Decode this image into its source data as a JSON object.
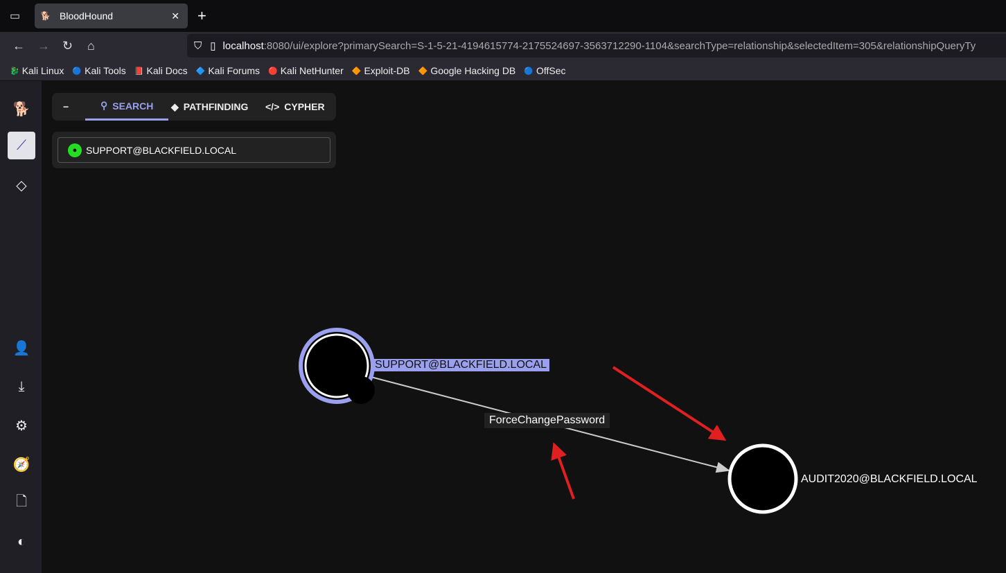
{
  "browser": {
    "tab_title": "BloodHound",
    "url_host": "localhost",
    "url_rest": ":8080/ui/explore?primarySearch=S-1-5-21-4194615774-2175524697-3563712290-1104&searchType=relationship&selectedItem=305&relationshipQueryTy",
    "bookmarks": [
      "Kali Linux",
      "Kali Tools",
      "Kali Docs",
      "Kali Forums",
      "Kali NetHunter",
      "Exploit-DB",
      "Google Hacking DB",
      "OffSec"
    ]
  },
  "search_panel": {
    "collapse": "−",
    "tabs": [
      "SEARCH",
      "PATHFINDING",
      "CYPHER"
    ],
    "query": "SUPPORT@BLACKFIELD.LOCAL"
  },
  "graph": {
    "source": "SUPPORT@BLACKFIELD.LOCAL",
    "target": "AUDIT2020@BLACKFIELD.LOCAL",
    "edge": "ForceChangePassword",
    "selected_color": "#9ba0ee",
    "annotation_color": "#e02020"
  }
}
